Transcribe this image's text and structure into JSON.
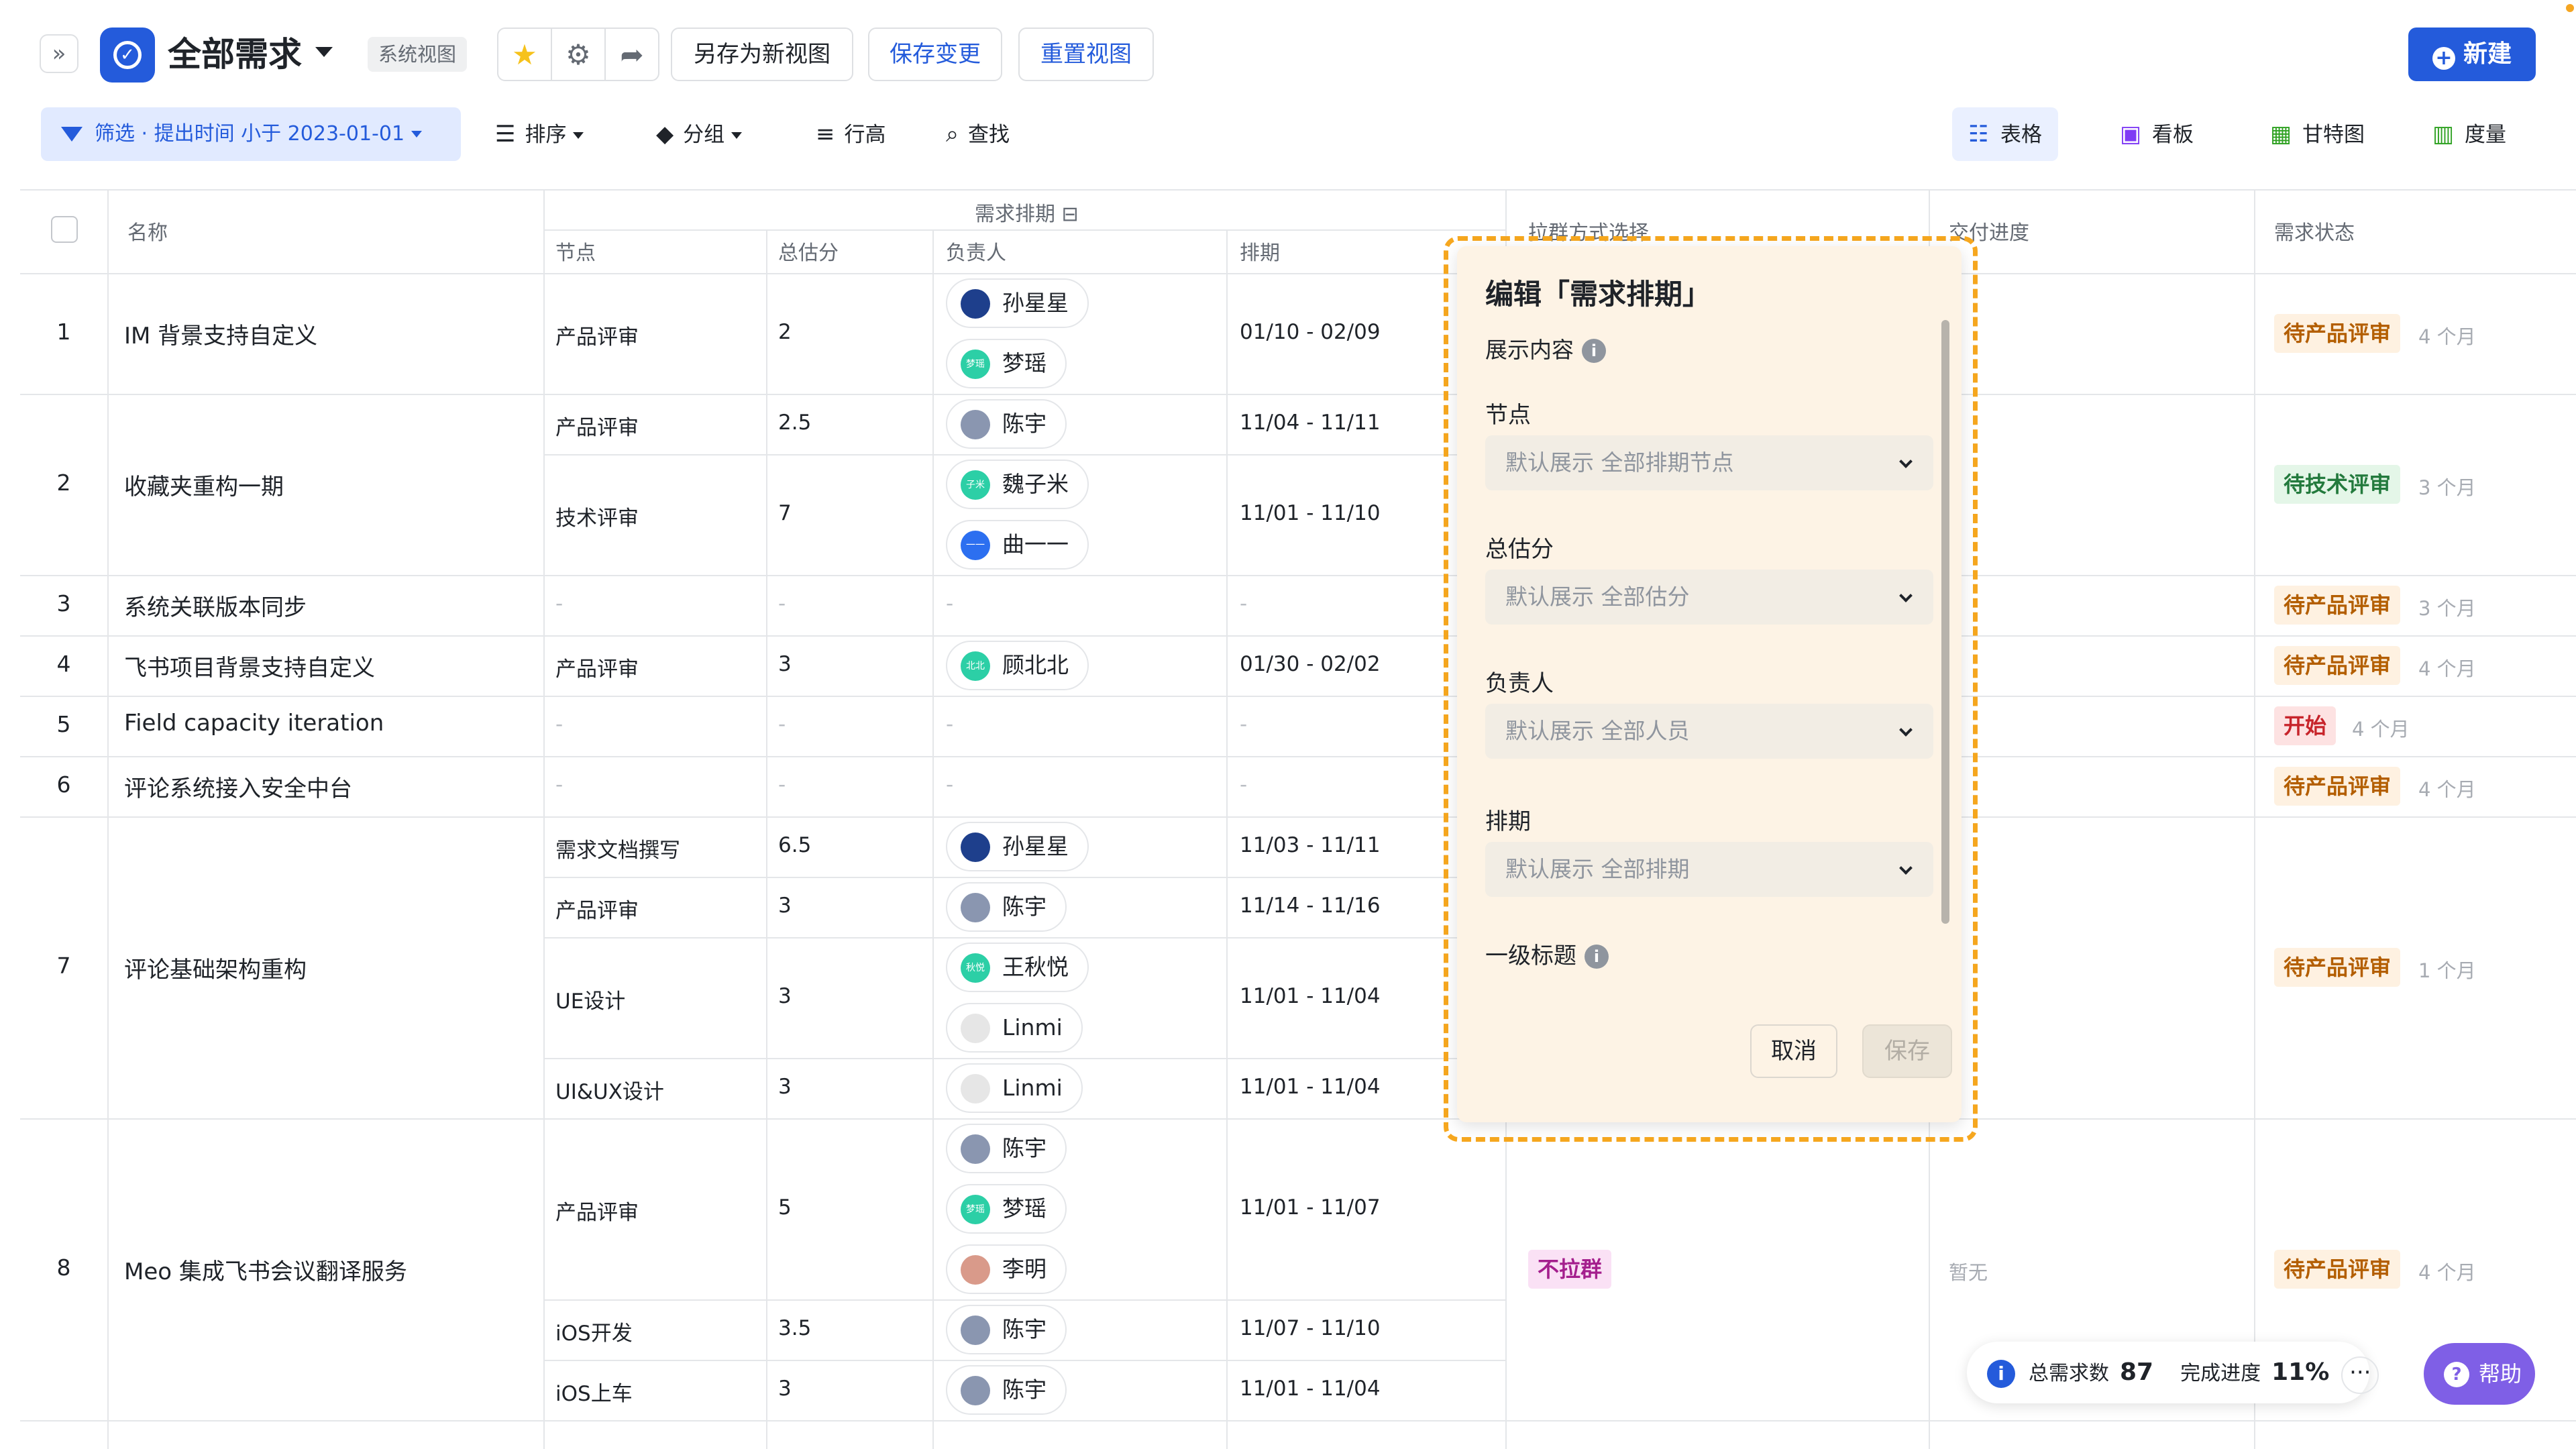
{
  "header": {
    "expand_icon": "»",
    "title": "全部需求",
    "system_view_tag": "系统视图",
    "save_as_label": "另存为新视图",
    "save_changes_label": "保存变更",
    "reset_view_label": "重置视图",
    "new_label": "新建",
    "accent_color": "#245bdb"
  },
  "toolbar": {
    "filter_label": "筛选 · 提出时间 小于 2023-01-01",
    "sort_label": "排序",
    "group_label": "分组",
    "row_height_label": "行高",
    "find_label": "查找",
    "view_tabs": [
      "表格",
      "看板",
      "甘特图",
      "度量"
    ],
    "active_view": "表格"
  },
  "table": {
    "headers": {
      "name": "名称",
      "schedule_group": "需求排期",
      "node": "节点",
      "score": "总估分",
      "owner": "负责人",
      "period": "排期",
      "pull_method": "拉群方式选择",
      "progress": "交付进度",
      "status": "需求状态"
    },
    "rows": [
      {
        "index": "1",
        "name": "IM 背景支持自定义",
        "status": "待产品评审",
        "ago": "4 个月",
        "nodes": [
          {
            "node": "产品评审",
            "score": "2",
            "owners": [
              "孙星星",
              "梦瑶"
            ],
            "period": "01/10 - 02/09"
          }
        ]
      },
      {
        "index": "2",
        "name": "收藏夹重构一期",
        "status": "待技术评审",
        "ago": "3 个月",
        "nodes": [
          {
            "node": "产品评审",
            "score": "2.5",
            "owners": [
              "陈宇"
            ],
            "period": "11/04 - 11/11"
          },
          {
            "node": "技术评审",
            "score": "7",
            "owners": [
              "魏子米",
              "曲一一"
            ],
            "period": "11/01 - 11/10"
          }
        ]
      },
      {
        "index": "3",
        "name": "系统关联版本同步",
        "status": "待产品评审",
        "ago": "3 个月",
        "nodes": []
      },
      {
        "index": "4",
        "name": "飞书项目背景支持自定义",
        "status": "待产品评审",
        "ago": "4 个月",
        "nodes": [
          {
            "node": "产品评审",
            "score": "3",
            "owners": [
              "顾北北"
            ],
            "period": "01/30 - 02/02"
          }
        ]
      },
      {
        "index": "5",
        "name": "Field capacity iteration",
        "status": "开始",
        "ago": "4 个月",
        "nodes": []
      },
      {
        "index": "6",
        "name": "评论系统接入安全中台",
        "status": "待产品评审",
        "ago": "4 个月",
        "nodes": []
      },
      {
        "index": "7",
        "name": "评论基础架构重构",
        "status": "待产品评审",
        "ago": "1 个月",
        "nodes": [
          {
            "node": "需求文档撰写",
            "score": "6.5",
            "owners": [
              "孙星星"
            ],
            "period": "11/03 - 11/11"
          },
          {
            "node": "产品评审",
            "score": "3",
            "owners": [
              "陈宇"
            ],
            "period": "11/14 - 11/16"
          },
          {
            "node": "UE设计",
            "score": "3",
            "owners": [
              "王秋悦",
              "Linmi"
            ],
            "period": "11/01 - 11/04"
          },
          {
            "node": "UI&UX设计",
            "score": "3",
            "owners": [
              "Linmi"
            ],
            "period": "11/01 - 11/04"
          }
        ]
      },
      {
        "index": "8",
        "name": "Meo 集成飞书会议翻译服务",
        "status": "待产品评审",
        "ago": "4 个月",
        "pull_method": "不拉群",
        "progress": "暂无",
        "nodes": [
          {
            "node": "产品评审",
            "score": "5",
            "owners": [
              "陈宇",
              "梦瑶",
              "李明"
            ],
            "period": "11/01 - 11/07"
          },
          {
            "node": "iOS开发",
            "score": "3.5",
            "owners": [
              "陈宇"
            ],
            "period": "11/07 - 11/10"
          },
          {
            "node": "iOS上车",
            "score": "3",
            "owners": [
              "陈宇"
            ],
            "period": "11/01 - 11/04"
          }
        ]
      }
    ],
    "empty_value": "-",
    "avatar_colors": {
      "孙星星": "#1e3f8c",
      "梦瑶": "#2ccfa6",
      "陈宇": "#8a96b0",
      "魏子米": "#2ccfa6",
      "曲一一": "#2c6ff0",
      "顾北北": "#2ccfa6",
      "王秋悦": "#2ccfa6",
      "Linmi": "#e6e6e6",
      "李明": "#d99a8a"
    },
    "avatar_initials": {
      "梦瑶": "梦瑶",
      "魏子米": "子米",
      "顾北北": "北北",
      "王秋悦": "秋悦",
      "曲一一": "一一"
    }
  },
  "popover": {
    "title": "编辑「需求排期」",
    "section_label": "展示内容",
    "fields": [
      {
        "label": "节点",
        "placeholder": "默认展示 全部排期节点"
      },
      {
        "label": "总估分",
        "placeholder": "默认展示 全部估分"
      },
      {
        "label": "负责人",
        "placeholder": "默认展示 全部人员"
      },
      {
        "label": "排期",
        "placeholder": "默认展示 全部排期"
      }
    ],
    "next_field_label": "一级标题",
    "cancel_label": "取消",
    "save_label": "保存",
    "highlight_color": "#f6a71f"
  },
  "footer": {
    "total_label": "总需求数",
    "total_value": "87",
    "progress_label": "完成进度",
    "progress_value": "11%",
    "more_icon": "···",
    "help_label": "帮助"
  }
}
